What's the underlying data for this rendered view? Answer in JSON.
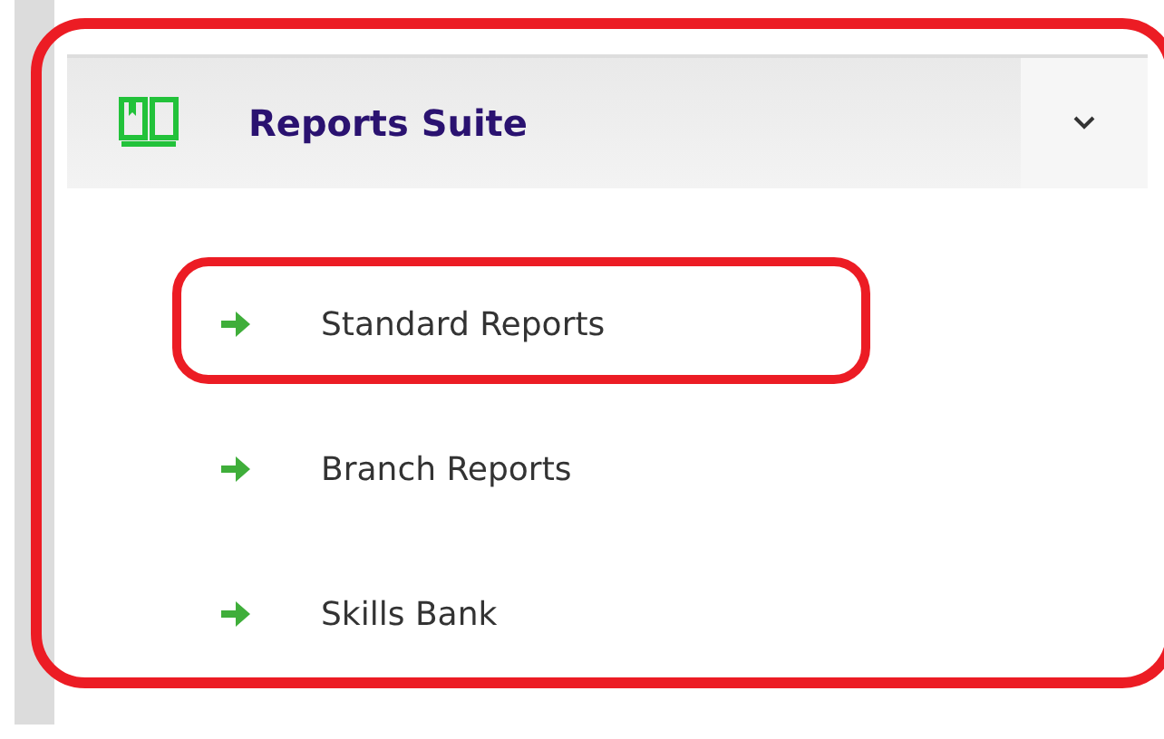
{
  "menu": {
    "title": "Reports Suite",
    "expanded": true,
    "annotated": true,
    "items": [
      {
        "label": "Standard Reports",
        "annotated": true
      },
      {
        "label": "Branch Reports",
        "annotated": false
      },
      {
        "label": "Skills Bank",
        "annotated": false
      }
    ]
  }
}
